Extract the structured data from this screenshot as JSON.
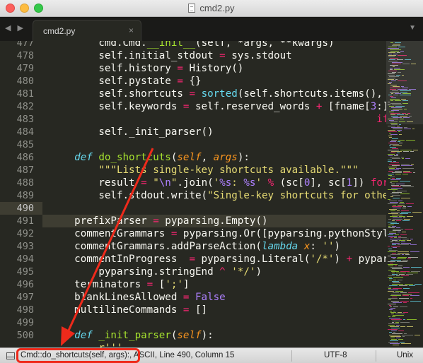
{
  "window": {
    "title": "cmd2.py"
  },
  "tabbar": {
    "nav_arrows": "◀ ▶",
    "dropdown": "▼"
  },
  "tabs": [
    {
      "label": "cmd2.py",
      "close": "×"
    }
  ],
  "editor": {
    "current_line": 490,
    "gutter": [
      "477",
      "478",
      "479",
      "480",
      "481",
      "482",
      "483",
      "484",
      "485",
      "486",
      "487",
      "488",
      "489",
      "490",
      "491",
      "492",
      "493",
      "494",
      "495",
      "496",
      "497",
      "498",
      "499",
      "500"
    ]
  },
  "statusbar": {
    "position_text": "Cmd::do_shortcuts(self, args):, ASCII, Line 490, Column 15",
    "encoding": "UTF-8",
    "line_endings": "Unix"
  },
  "colors": {
    "background": "#272822",
    "keyword": "#66d9ef",
    "function": "#a6e22e",
    "operator": "#f92672",
    "string": "#e6db74",
    "number": "#ae81ff",
    "parameter": "#fd971f",
    "comment": "#75715e",
    "annotation": "#ee2a1b"
  },
  "icons": [
    "close-window-icon",
    "minimize-window-icon",
    "zoom-window-icon",
    "document-icon",
    "panel-toggle-icon",
    "chevron-down-icon"
  ]
}
